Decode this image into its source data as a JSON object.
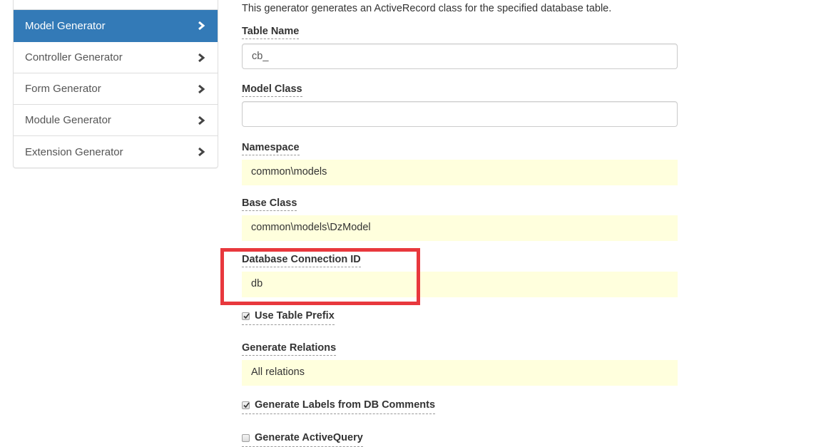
{
  "sidebar": {
    "items": [
      {
        "label": "Model Generator",
        "active": true,
        "icon": "chevron-right-icon"
      },
      {
        "label": "Controller Generator",
        "active": false,
        "icon": "chevron-right-icon"
      },
      {
        "label": "Form Generator",
        "active": false,
        "icon": "chevron-right-icon"
      },
      {
        "label": "Module Generator",
        "active": false,
        "icon": "chevron-right-icon"
      },
      {
        "label": "Extension Generator",
        "active": false,
        "icon": "chevron-right-icon"
      }
    ]
  },
  "main": {
    "description": "This generator generates an ActiveRecord class for the specified database table.",
    "fields": {
      "table_name": {
        "label": "Table Name",
        "value": "cb_"
      },
      "model_class": {
        "label": "Model Class",
        "value": ""
      },
      "namespace": {
        "label": "Namespace",
        "value": "common\\models"
      },
      "base_class": {
        "label": "Base Class",
        "value": "common\\models\\DzModel"
      },
      "db_connection": {
        "label": "Database Connection ID",
        "value": "db"
      },
      "use_table_prefix": {
        "label": "Use Table Prefix",
        "checked": true
      },
      "generate_relations": {
        "label": "Generate Relations",
        "value": "All relations"
      },
      "labels_from_db": {
        "label": "Generate Labels from DB Comments",
        "checked": true
      },
      "generate_query": {
        "label": "Generate ActiveQuery",
        "checked": false
      }
    }
  },
  "colors": {
    "active_item": "#337ab7",
    "sticky_field": "#ffffdd",
    "annotation_box": "#e8383d"
  }
}
